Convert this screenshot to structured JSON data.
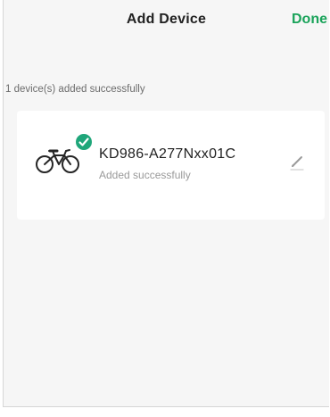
{
  "header": {
    "title": "Add Device",
    "done_label": "Done"
  },
  "status": {
    "message": "1 device(s) added successfully"
  },
  "device": {
    "name": "KD986-A277Nxx01C",
    "status": "Added successfully",
    "icon": "bicycle-icon",
    "badge_icon": "check-circle-icon",
    "edit_icon": "pencil-icon"
  },
  "colors": {
    "accent": "#1aa35a",
    "badge": "#1fa67a",
    "background": "#f6f6f6",
    "card": "#ffffff"
  }
}
